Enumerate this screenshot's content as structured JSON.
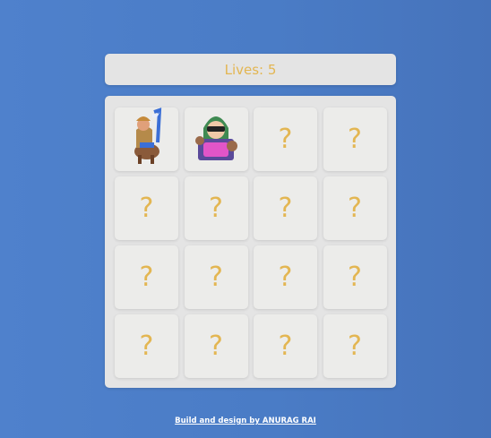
{
  "header": {
    "lives_label": "Lives: 5"
  },
  "board": {
    "cards": [
      {
        "state": "revealed",
        "icon": "knight-rider-icon"
      },
      {
        "state": "revealed",
        "icon": "bandit-chest-icon"
      },
      {
        "state": "hidden",
        "label": "?"
      },
      {
        "state": "hidden",
        "label": "?"
      },
      {
        "state": "hidden",
        "label": "?"
      },
      {
        "state": "hidden",
        "label": "?"
      },
      {
        "state": "hidden",
        "label": "?"
      },
      {
        "state": "hidden",
        "label": "?"
      },
      {
        "state": "hidden",
        "label": "?"
      },
      {
        "state": "hidden",
        "label": "?"
      },
      {
        "state": "hidden",
        "label": "?"
      },
      {
        "state": "hidden",
        "label": "?"
      },
      {
        "state": "hidden",
        "label": "?"
      },
      {
        "state": "hidden",
        "label": "?"
      },
      {
        "state": "hidden",
        "label": "?"
      },
      {
        "state": "hidden",
        "label": "?"
      }
    ]
  },
  "footer": {
    "credit": "Build and design by ANURAG RAI"
  }
}
